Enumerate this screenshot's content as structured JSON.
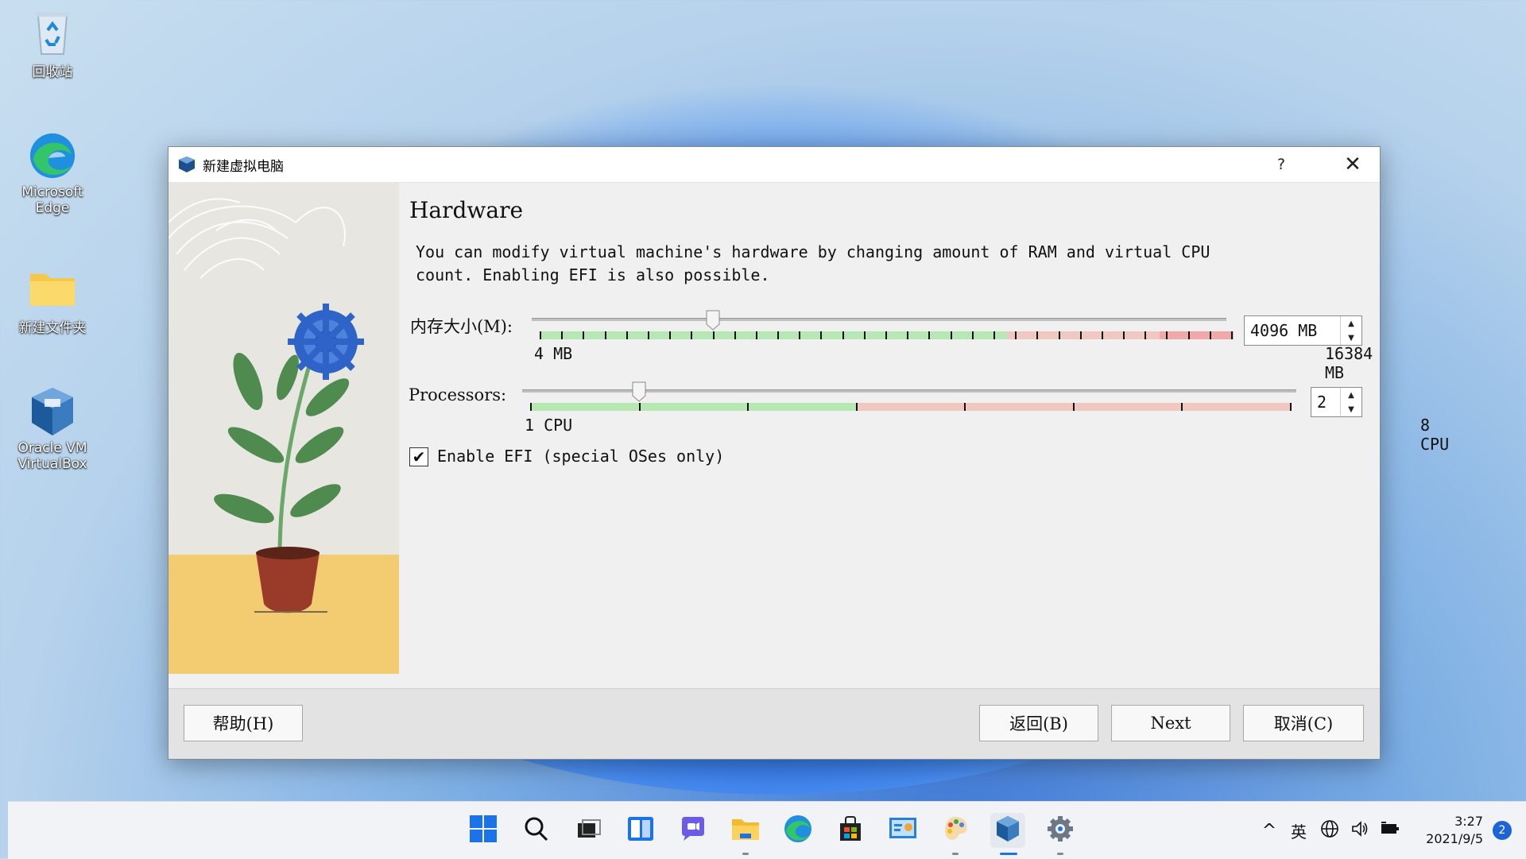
{
  "desktop": {
    "icons": [
      {
        "label": "回收站"
      },
      {
        "label": "Microsoft Edge"
      },
      {
        "label": "新建文件夹"
      },
      {
        "label": "Oracle VM VirtualBox"
      }
    ]
  },
  "dialog": {
    "title": "新建虚拟电脑",
    "help_glyph": "?",
    "close_glyph": "✕",
    "heading": "Hardware",
    "description": "You can modify virtual machine's hardware by changing amount of RAM and virtual CPU count. Enabling EFI is also possible.",
    "memory": {
      "label": "内存大小(M):",
      "value": "4096 MB",
      "min_label": "4 MB",
      "max_label": "16384 MB",
      "min": 4,
      "max": 16384,
      "current": 4096
    },
    "processors": {
      "label": "Processors:",
      "value": "2",
      "min_label": "1 CPU",
      "max_label": "8 CPU",
      "min": 1,
      "max": 8,
      "current": 2
    },
    "efi": {
      "label": "Enable EFI (special OSes only)",
      "checked": true
    },
    "buttons": {
      "help": "帮助(H)",
      "back": "返回(B)",
      "next": "Next",
      "cancel": "取消(C)"
    }
  },
  "taskbar": {
    "tray": {
      "chevron": "^",
      "ime": "英"
    },
    "clock": {
      "time": "3:27",
      "date": "2021/9/5"
    },
    "notifications": "2"
  },
  "colors": {
    "scale_green": "#b7e8b4",
    "scale_red": "#f0c8c0",
    "scale_dark_red": "#f0a8a8",
    "accent": "#1d63d8"
  }
}
